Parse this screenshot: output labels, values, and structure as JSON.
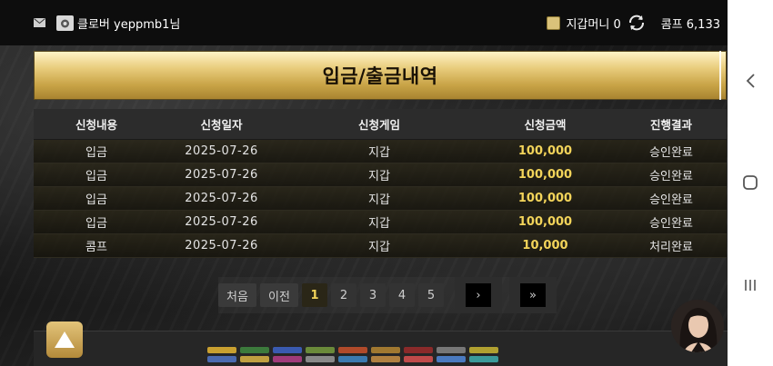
{
  "topbar": {
    "username": "클로버 yeppmb1님",
    "wallet_label": "지갑머니 0",
    "comp_label": "콤프 6,133"
  },
  "title": "입금/출금내역",
  "table": {
    "headers": [
      "신청내용",
      "신청일자",
      "신청게임",
      "신청금액",
      "진행결과"
    ],
    "rows": [
      {
        "type": "입금",
        "date": "2025-07-26",
        "game": "지갑",
        "amount": "100,000",
        "status": "승인완료"
      },
      {
        "type": "입금",
        "date": "2025-07-26",
        "game": "지갑",
        "amount": "100,000",
        "status": "승인완료"
      },
      {
        "type": "입금",
        "date": "2025-07-26",
        "game": "지갑",
        "amount": "100,000",
        "status": "승인완료"
      },
      {
        "type": "입금",
        "date": "2025-07-26",
        "game": "지갑",
        "amount": "100,000",
        "status": "승인완료"
      },
      {
        "type": "콤프",
        "date": "2025-07-26",
        "game": "지갑",
        "amount": "10,000",
        "status": "처리완료"
      }
    ]
  },
  "pagination": {
    "first": "처음",
    "prev": "이전",
    "pages": [
      "1",
      "2",
      "3",
      "4",
      "5"
    ],
    "current": "1",
    "next": "›",
    "last": "»"
  },
  "icons": {
    "mail": "mail-icon",
    "level": "level-badge-icon",
    "wallet": "wallet-icon",
    "refresh": "refresh-icon",
    "scroll_top": "arrow-up-icon",
    "nav_back": "chevron-left-icon",
    "nav_home": "home-square-icon",
    "nav_recents": "recents-icon"
  },
  "colors": {
    "accent_gold": "#f3d45a",
    "banner_gold": "#c9a447"
  }
}
